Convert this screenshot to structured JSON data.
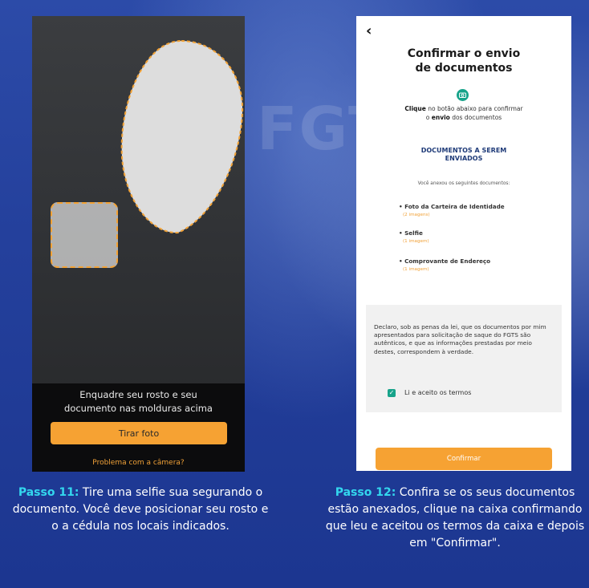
{
  "left_screen": {
    "instruction_line1": "Enquadre seu rosto e seu",
    "instruction_line2": "documento nas molduras acima",
    "take_photo_button": "Tirar foto",
    "camera_problem_link": "Problema com a câmera?"
  },
  "caption_left": {
    "step": "Passo 11:",
    "text": "Tire uma selfie sua segurando o documento. Você deve posicionar seu rosto e o a cédula nos locais indicados."
  },
  "right_screen": {
    "back_icon": "chevron-left",
    "title_line1": "Confirmar o envio",
    "title_line2": "de documentos",
    "camera_icon": "camera-icon",
    "desc_bold1": "Clique",
    "desc_mid": " no botão abaixo para confirmar",
    "desc_pre": "o ",
    "desc_bold2": "envio",
    "desc_post": " dos documentos",
    "section_line1": "DOCUMENTOS A SEREM",
    "section_line2": "ENVIADOS",
    "attached_intro": "Você anexou os seguintes documentos:",
    "documents": [
      {
        "name": "• Foto da Carteira de Identidade",
        "count": "(2 imagens)"
      },
      {
        "name": "• Selfie",
        "count": "(1 imagem)"
      },
      {
        "name": "• Comprovante de Endereço",
        "count": "(1 imagem)"
      }
    ],
    "declaration": "Declaro, sob as penas da lei, que os documentos por mim apresentados para solicitação de saque do FGTS são autênticos, e que as informações prestadas por meio destes, correspondem à verdade.",
    "terms_label": "Li e aceito os termos",
    "terms_checked": true,
    "confirm_button": "Confirmar"
  },
  "caption_right": {
    "step": "Passo 12:",
    "text": "Confira se os seus documentos estão anexados, clique na caixa confirmando que leu e aceitou os termos da caixa e depois em \"Confirmar\"."
  },
  "background_text": {
    "word": "FGTS"
  },
  "colors": {
    "accent_orange": "#f6a233",
    "teal": "#17a38a",
    "step_cyan": "#33d7ee",
    "navy": "#1e3a78"
  }
}
